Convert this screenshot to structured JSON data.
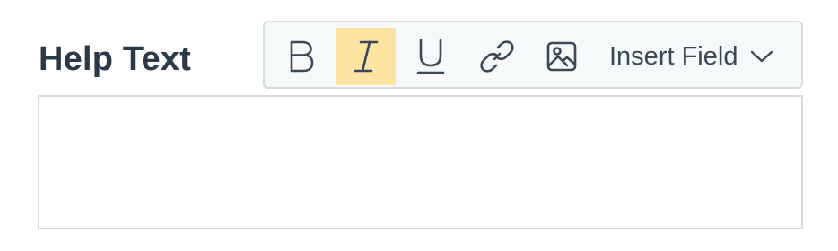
{
  "field": {
    "label": "Help Text",
    "value": ""
  },
  "toolbar": {
    "buttons": [
      {
        "name": "bold",
        "icon": "bold-icon",
        "active": false
      },
      {
        "name": "italic",
        "icon": "italic-icon",
        "active": true
      },
      {
        "name": "underline",
        "icon": "underline-icon",
        "active": false
      },
      {
        "name": "link",
        "icon": "link-icon",
        "active": false
      },
      {
        "name": "image",
        "icon": "image-icon",
        "active": false
      }
    ],
    "insert_field_label": "Insert Field",
    "insert_field_icon": "chevron-down-icon"
  },
  "colors": {
    "label_text": "#2b3a4a",
    "icon": "#3b4856",
    "active_highlight": "#fce5a2",
    "toolbar_bg": "#f6f9f9",
    "border": "#d4dcde"
  }
}
